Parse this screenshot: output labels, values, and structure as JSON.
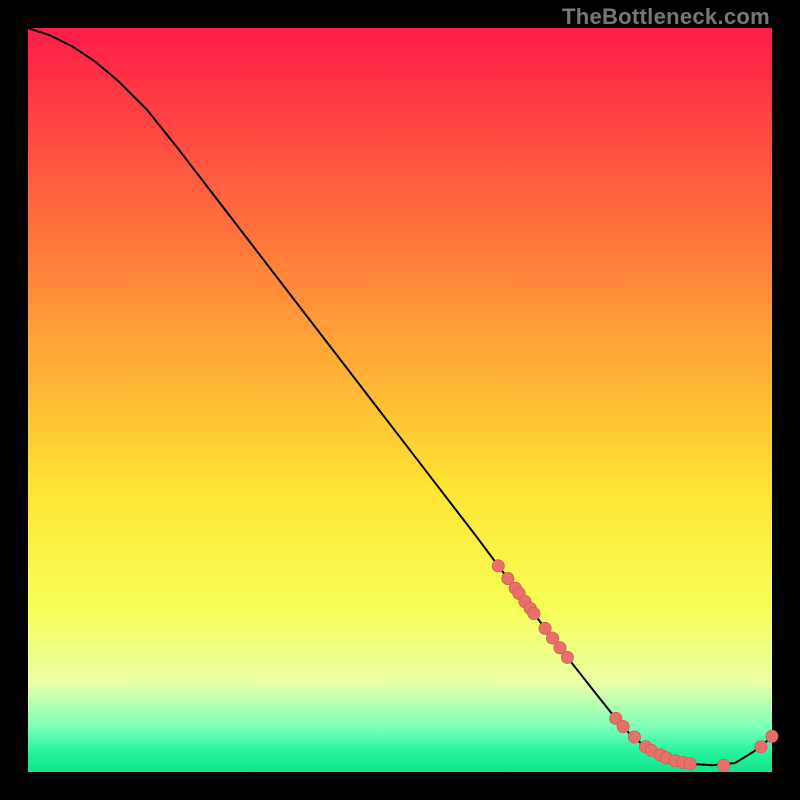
{
  "watermark": "TheBottleneck.com",
  "colors": {
    "bg_black": "#000000",
    "line": "#000000",
    "marker_fill": "#E97068",
    "marker_stroke": "#C9544C",
    "grad_top": "#FF1C49",
    "grad_mid_upper": "#FF7B3A",
    "grad_mid": "#FFE534",
    "grad_low_yellow": "#F7FF57",
    "grad_pale": "#EBFFA8",
    "grad_green1": "#7CFFBB",
    "grad_green2": "#2CF59F",
    "grad_green3": "#0FE48C"
  },
  "chart_data": {
    "type": "line",
    "title": "",
    "xlabel": "",
    "ylabel": "",
    "xlim": [
      0,
      100
    ],
    "ylim": [
      0,
      100
    ],
    "series": [
      {
        "name": "curve",
        "x": [
          0,
          3,
          6,
          9,
          12,
          16,
          20,
          25,
          30,
          35,
          40,
          45,
          50,
          55,
          60,
          63,
          66,
          68,
          71,
          74,
          77,
          79,
          81,
          83,
          85,
          87,
          89,
          92,
          95,
          97,
          98.5,
          100
        ],
        "y": [
          100,
          99,
          97.5,
          95.5,
          93,
          89,
          84,
          77.5,
          71,
          64.5,
          58,
          51.5,
          45,
          38.5,
          32,
          28,
          24,
          21.3,
          17.3,
          13.5,
          9.7,
          7.2,
          5,
          3.4,
          2.3,
          1.5,
          1.1,
          0.9,
          1.2,
          2.4,
          3.4,
          4.8
        ]
      }
    ],
    "markers": {
      "name": "points",
      "x": [
        63.2,
        64.5,
        65.5,
        66.0,
        66.8,
        67.5,
        68.0,
        69.5,
        70.5,
        71.5,
        72.5,
        79.0,
        80.0,
        81.5,
        83.0,
        83.8,
        85.0,
        85.8,
        87.0,
        88.0,
        89.0,
        93.5,
        98.5,
        100.0
      ],
      "y": [
        27.7,
        26.0,
        24.7,
        24.0,
        22.9,
        22.0,
        21.3,
        19.3,
        18.0,
        16.7,
        15.4,
        7.2,
        6.1,
        4.7,
        3.4,
        2.9,
        2.3,
        1.9,
        1.5,
        1.3,
        1.1,
        0.9,
        3.4,
        4.8
      ]
    },
    "gradient_stops": [
      {
        "offset": 0.0,
        "color_key": "grad_top"
      },
      {
        "offset": 0.3,
        "color_key": "grad_mid_upper"
      },
      {
        "offset": 0.62,
        "color_key": "grad_mid"
      },
      {
        "offset": 0.78,
        "color_key": "grad_low_yellow"
      },
      {
        "offset": 0.88,
        "color_key": "grad_pale"
      },
      {
        "offset": 0.94,
        "color_key": "grad_green1"
      },
      {
        "offset": 0.97,
        "color_key": "grad_green2"
      },
      {
        "offset": 1.0,
        "color_key": "grad_green3"
      }
    ]
  }
}
